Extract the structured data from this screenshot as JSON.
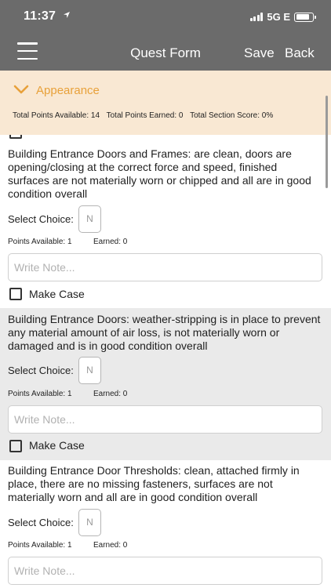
{
  "status": {
    "time": "11:37",
    "location_icon": "location-arrow-icon",
    "network": "5G E",
    "battery_level": 0.8
  },
  "nav": {
    "menu_icon": "hamburger-menu-icon",
    "title": "Quest Form",
    "save_label": "Save",
    "back_label": "Back"
  },
  "section": {
    "chevron_icon": "chevron-down-icon",
    "title": "Appearance",
    "total_available": "Total Points Available: 14",
    "total_earned": "Total Points Earned: 0",
    "section_score": "Total Section Score: 0%"
  },
  "colors": {
    "nav_bg": "#6b6b6b",
    "section_bg": "#f9e8d3",
    "accent": "#e8a13a",
    "alt_row_bg": "#eaeaea"
  },
  "items": [
    {
      "text": "Building Entrance Doors and Frames: are clean, doors are opening/closing at the correct force and speed, finished surfaces are not materially worn or chipped and all are in good condition overall",
      "select_label": "Select Choice:",
      "choice_value": "N",
      "points_available": "Points Available: 1",
      "earned": "Earned: 0",
      "note_placeholder": "Write Note...",
      "case_label": "Make Case"
    },
    {
      "text": "Building Entrance Doors: weather-stripping is in place to prevent any material amount of air loss, is not materially worn or damaged and is in good condition overall",
      "select_label": "Select Choice:",
      "choice_value": "N",
      "points_available": "Points Available: 1",
      "earned": "Earned: 0",
      "note_placeholder": "Write Note...",
      "case_label": "Make Case"
    },
    {
      "text": "Building Entrance Door Thresholds: clean, attached firmly in place, there are no missing fasteners, surfaces are not materially worn and all are in good condition overall",
      "select_label": "Select Choice:",
      "choice_value": "N",
      "points_available": "Points Available: 1",
      "earned": "Earned: 0",
      "note_placeholder": "Write Note..."
    }
  ]
}
